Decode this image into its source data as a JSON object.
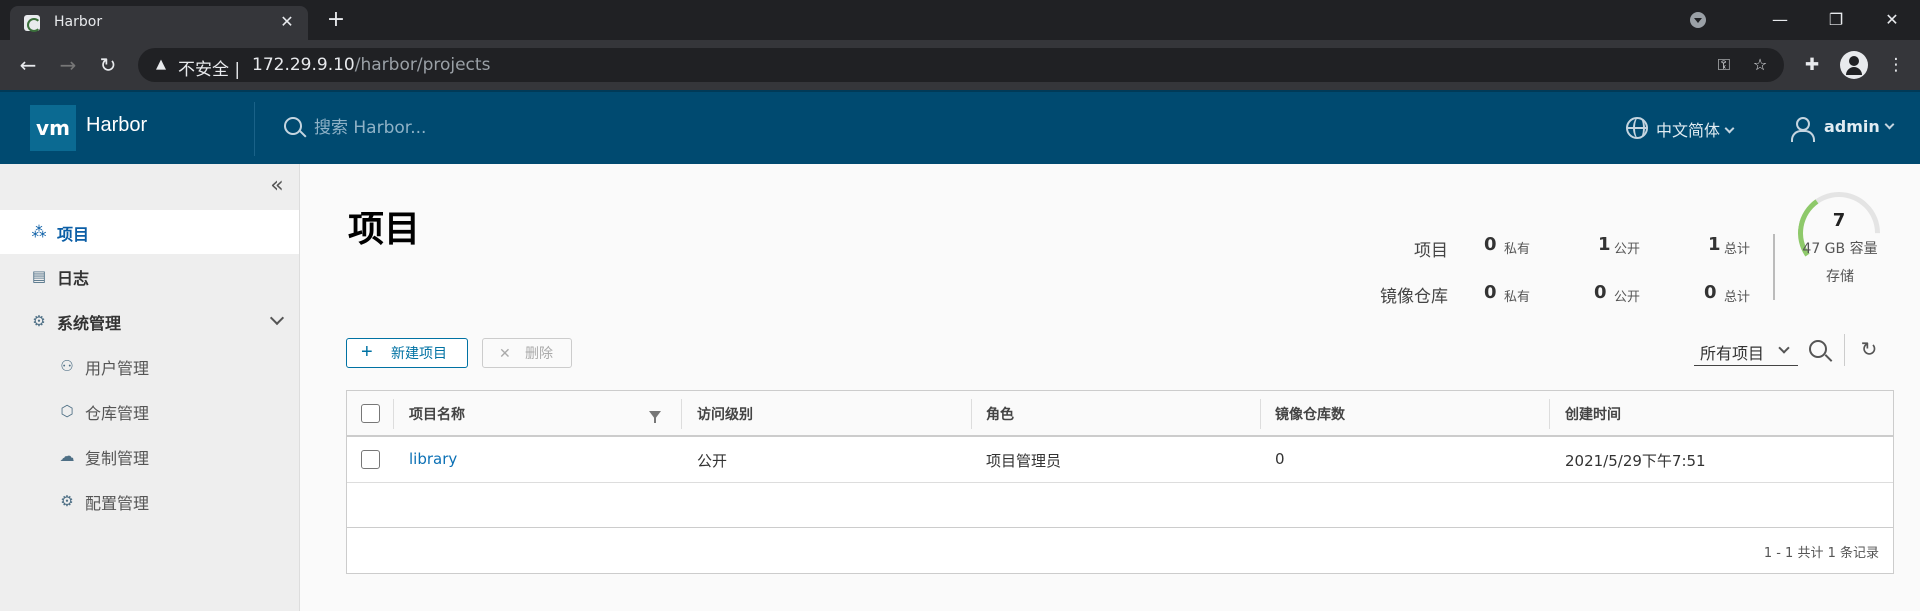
{
  "browser": {
    "tab_title": "Harbor",
    "address_insecure": "不安全",
    "address_separator": "|",
    "address_host": "172.29.9.10",
    "address_path": "/harbor/projects"
  },
  "header": {
    "logo_text": "vm",
    "brand": "Harbor",
    "search_placeholder": "搜索 Harbor...",
    "language": "中文简体",
    "user": "admin"
  },
  "sidebar": {
    "collapse_glyph": "«",
    "items": [
      {
        "label": "项目",
        "icon": "projects-icon",
        "glyph": "⁂"
      },
      {
        "label": "日志",
        "icon": "logs-icon",
        "glyph": "▤"
      },
      {
        "label": "系统管理",
        "icon": "admin-icon",
        "glyph": "⚙"
      },
      {
        "label": "用户管理",
        "icon": "users-icon",
        "glyph": "⚇"
      },
      {
        "label": "仓库管理",
        "icon": "registries-icon",
        "glyph": "⬡"
      },
      {
        "label": "复制管理",
        "icon": "replications-icon",
        "glyph": "☁"
      },
      {
        "label": "配置管理",
        "icon": "configuration-icon",
        "glyph": "⚙"
      }
    ]
  },
  "main": {
    "title": "项目",
    "stats": {
      "row1_label": "项目",
      "row2_label": "镜像仓库",
      "private_label": "私有",
      "public_label": "公开",
      "total_label": "总计",
      "projects": {
        "private": "0",
        "public": "1",
        "total": "1"
      },
      "repos": {
        "private": "0",
        "public": "0",
        "total": "0"
      }
    },
    "storage": {
      "value": "7",
      "capacity": "47 GB 容量",
      "label": "存储",
      "used_fraction": 0.15,
      "fill_color": "#8ec96a"
    },
    "actions": {
      "new_label": "新建项目",
      "delete_label": "删除",
      "filter_value": "所有项目"
    },
    "grid": {
      "columns": [
        "项目名称",
        "访问级别",
        "角色",
        "镜像仓库数",
        "创建时间"
      ],
      "rows": [
        {
          "name": "library",
          "access": "公开",
          "role": "项目管理员",
          "repo_count": "0",
          "created": "2021/5/29下午7:51"
        }
      ],
      "pagination": "1 - 1 共计 1 条记录"
    }
  }
}
